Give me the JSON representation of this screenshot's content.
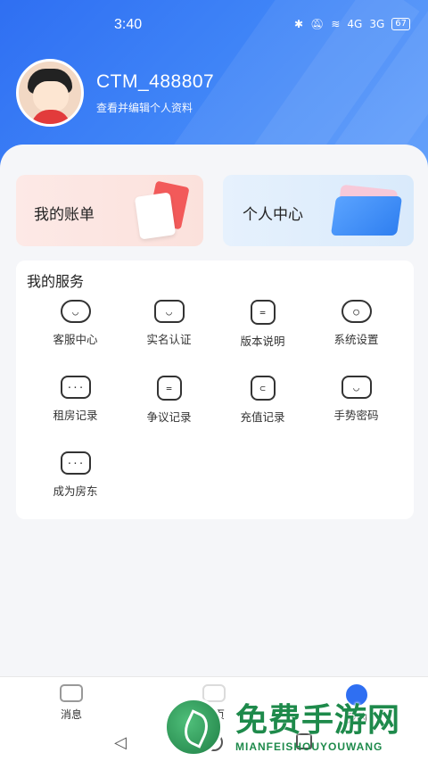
{
  "status_bar": {
    "time": "3:40",
    "signal1": "4G",
    "signal2": "3G",
    "battery": "67"
  },
  "profile": {
    "username": "CTM_488807",
    "subtitle": "查看并编辑个人资料"
  },
  "quick": {
    "bill_label": "我的账单",
    "center_label": "个人中心"
  },
  "services": {
    "title": "我的服务",
    "items": [
      {
        "label": "客服中心",
        "icon": "chat-bubble-icon"
      },
      {
        "label": "实名认证",
        "icon": "verify-icon"
      },
      {
        "label": "版本说明",
        "icon": "document-icon"
      },
      {
        "label": "系统设置",
        "icon": "hexagon-settings-icon"
      },
      {
        "label": "租房记录",
        "icon": "more-dots-icon"
      },
      {
        "label": "争议记录",
        "icon": "document-icon"
      },
      {
        "label": "充值记录",
        "icon": "wallet-icon"
      },
      {
        "label": "手势密码",
        "icon": "gesture-icon"
      },
      {
        "label": "成为房东",
        "icon": "more-dots-icon"
      }
    ]
  },
  "bottom_nav": {
    "messages": "消息",
    "home": "首页",
    "mine": "我的"
  },
  "watermark": {
    "title": "免费手游网",
    "subtitle": "MIANFEISHOUYOUWANG"
  },
  "colors": {
    "primary": "#2f6ff2",
    "watermark": "#1e8a4b"
  }
}
